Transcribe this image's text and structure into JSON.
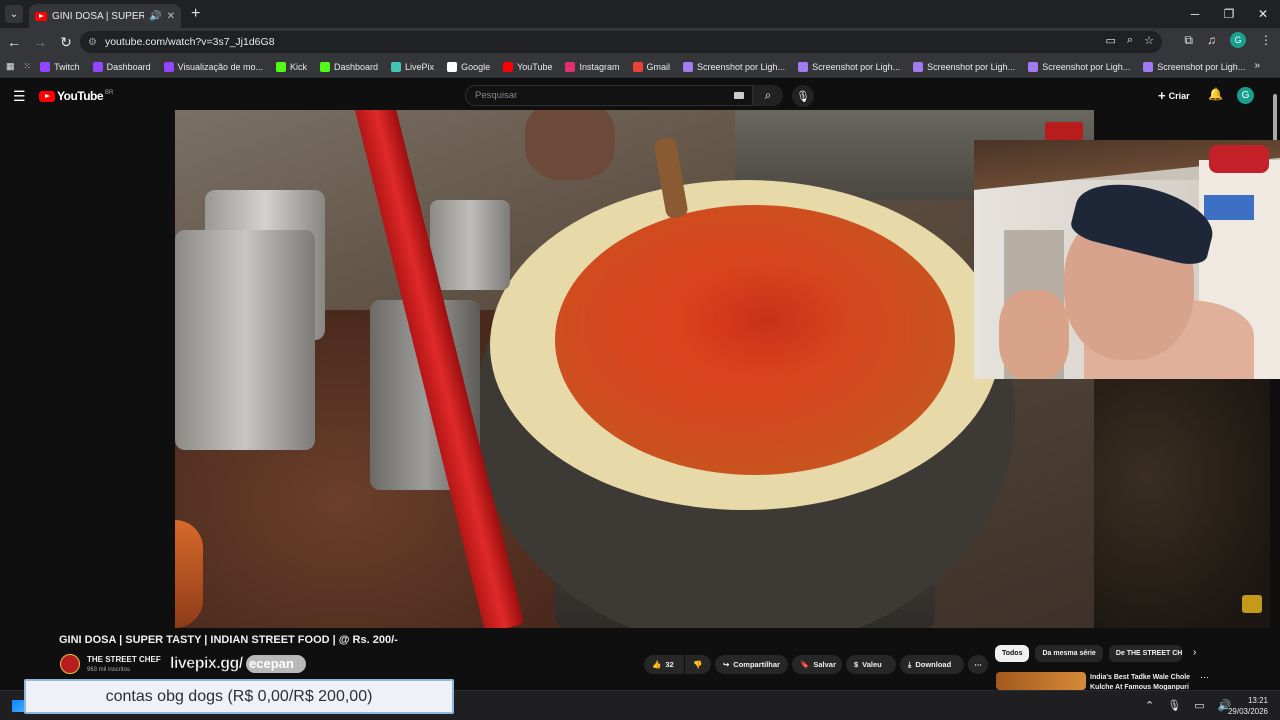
{
  "browser": {
    "tab_title": "GINI DOSA | SUPER TASTY |",
    "url": "youtube.com/watch?v=3s7_Jj1d6G8",
    "bookmarks": [
      {
        "label": "Twitch",
        "color": "#9146ff"
      },
      {
        "label": "Dashboard",
        "color": "#9146ff"
      },
      {
        "label": "Visualização de mo...",
        "color": "#9146ff"
      },
      {
        "label": "Kick",
        "color": "#53fc18"
      },
      {
        "label": "Dashboard",
        "color": "#53fc18"
      },
      {
        "label": "LivePix",
        "color": "#41c6b7"
      },
      {
        "label": "Google",
        "color": "#ffffff"
      },
      {
        "label": "YouTube",
        "color": "#ff0000"
      },
      {
        "label": "Instagram",
        "color": "#e1306c"
      },
      {
        "label": "Gmail",
        "color": "#ea4335"
      },
      {
        "label": "Screenshot por Ligh...",
        "color": "#a07cf0"
      },
      {
        "label": "Screenshot por Ligh...",
        "color": "#a07cf0"
      },
      {
        "label": "Screenshot por Ligh...",
        "color": "#a07cf0"
      },
      {
        "label": "Screenshot por Ligh...",
        "color": "#a07cf0"
      },
      {
        "label": "Screenshot por Ligh...",
        "color": "#a07cf0"
      }
    ]
  },
  "youtube": {
    "logo_text": "YouTube",
    "logo_region": "BR",
    "search_placeholder": "Pesquisar",
    "create_label": "Criar",
    "avatar_letter": "G"
  },
  "video": {
    "title": "GINI DOSA | SUPER TASTY | INDIAN STREET FOOD | @ Rs. 200/-",
    "channel": "THE STREET CHEF",
    "subscribers": "963 mil inscritos",
    "likes": "32",
    "share_label": "Compartilhar",
    "save_label": "Salvar",
    "thanks_label": "Valeu",
    "download_label": "Download"
  },
  "overlay": {
    "livepix_text": "livepix.gg/",
    "livepix_handle": "ecepan",
    "donation_text": "contas obg dogs (R$ 0,00/R$ 200,00)"
  },
  "chips": [
    "Todos",
    "Da mesma série",
    "De THE STREET CHEF"
  ],
  "recommendation": {
    "title": "India's Best Tadke Wale Chole Kulche At Famous Moganpuri"
  },
  "taskbar": {
    "time": "13:21",
    "date": "29/03/2026"
  }
}
